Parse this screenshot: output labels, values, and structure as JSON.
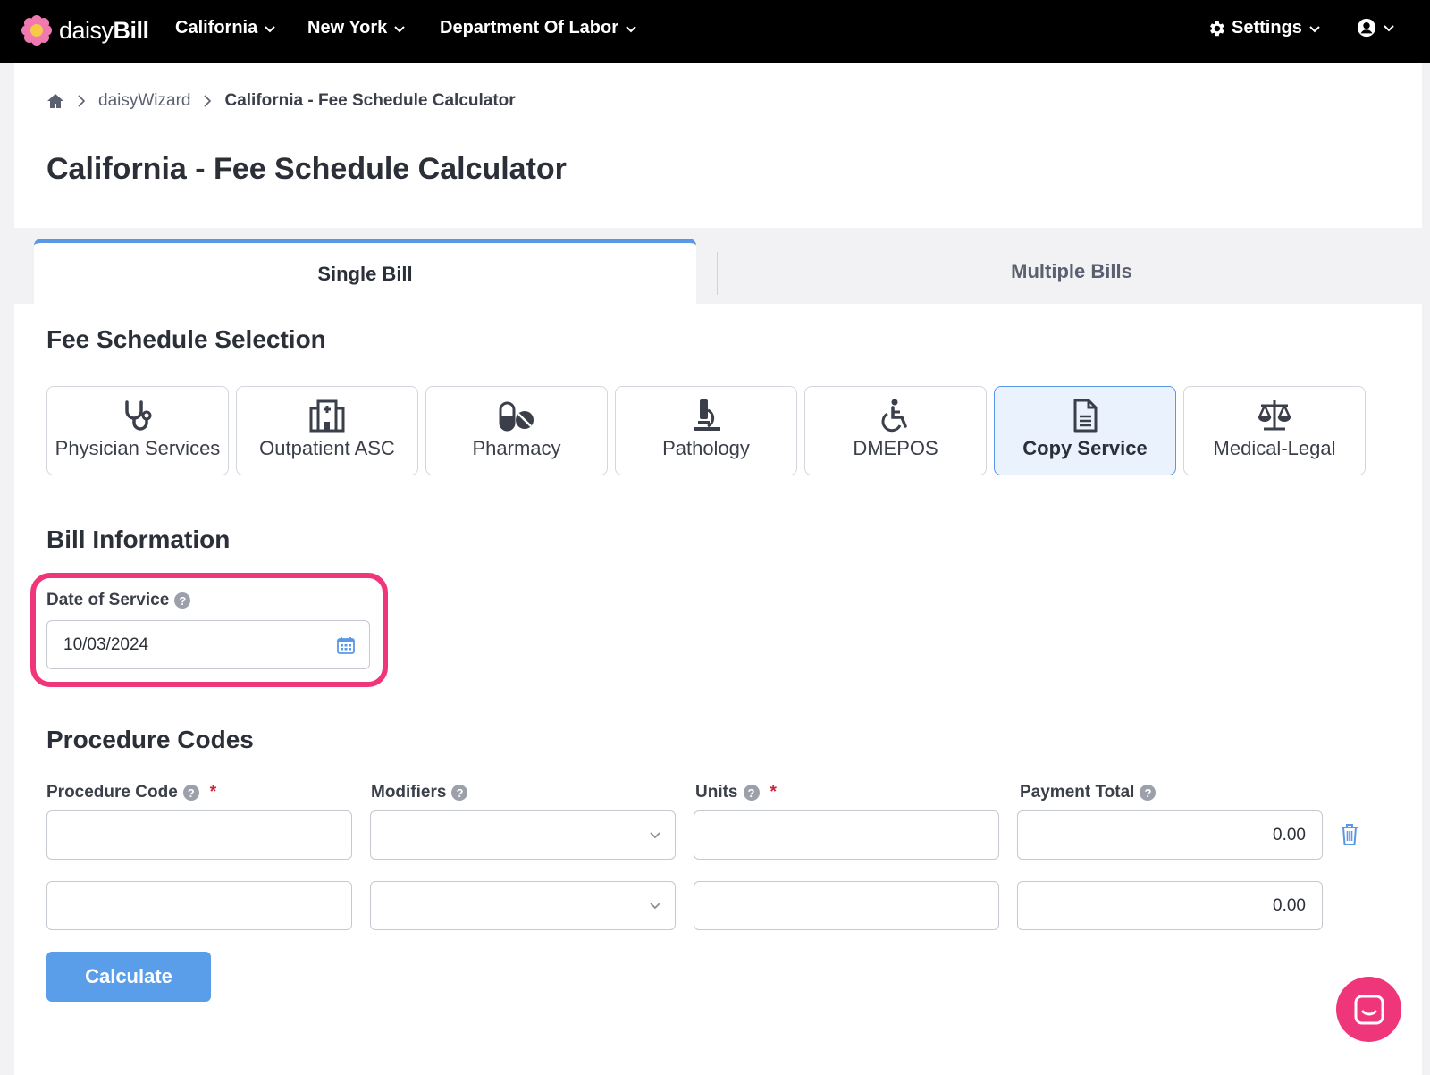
{
  "nav": {
    "brand_light": "daisy",
    "brand_bold": "Bill",
    "items": [
      {
        "label": "California"
      },
      {
        "label": "New York"
      },
      {
        "label": "Department Of Labor"
      }
    ],
    "settings_label": "Settings"
  },
  "breadcrumb": {
    "items": [
      "daisyWizard",
      "California - Fee Schedule Calculator"
    ]
  },
  "page": {
    "title": "California - Fee Schedule Calculator"
  },
  "tabs": [
    {
      "label": "Single Bill",
      "active": true
    },
    {
      "label": "Multiple Bills",
      "active": false
    }
  ],
  "fee_schedule": {
    "title": "Fee Schedule Selection",
    "options": [
      {
        "label": "Physician Services",
        "icon": "stethoscope-icon",
        "selected": false
      },
      {
        "label": "Outpatient ASC",
        "icon": "hospital-icon",
        "selected": false
      },
      {
        "label": "Pharmacy",
        "icon": "pills-icon",
        "selected": false
      },
      {
        "label": "Pathology",
        "icon": "microscope-icon",
        "selected": false
      },
      {
        "label": "DMEPOS",
        "icon": "wheelchair-icon",
        "selected": false
      },
      {
        "label": "Copy Service",
        "icon": "document-icon",
        "selected": true
      },
      {
        "label": "Medical-Legal",
        "icon": "scales-icon",
        "selected": false
      }
    ]
  },
  "bill_info": {
    "title": "Bill Information",
    "date_label": "Date of Service",
    "date_value": "10/03/2024"
  },
  "procedure": {
    "title": "Procedure Codes",
    "columns": [
      "Procedure Code",
      "Modifiers",
      "Units",
      "Payment Total"
    ],
    "rows": [
      {
        "code": "",
        "modifier": "",
        "units": "",
        "payment": "0.00"
      },
      {
        "code": "",
        "modifier": "",
        "units": "",
        "payment": "0.00"
      }
    ]
  },
  "actions": {
    "calculate_label": "Calculate"
  },
  "colors": {
    "accent": "#5a97e6",
    "highlight": "#f0367a",
    "required": "#d0203a"
  }
}
